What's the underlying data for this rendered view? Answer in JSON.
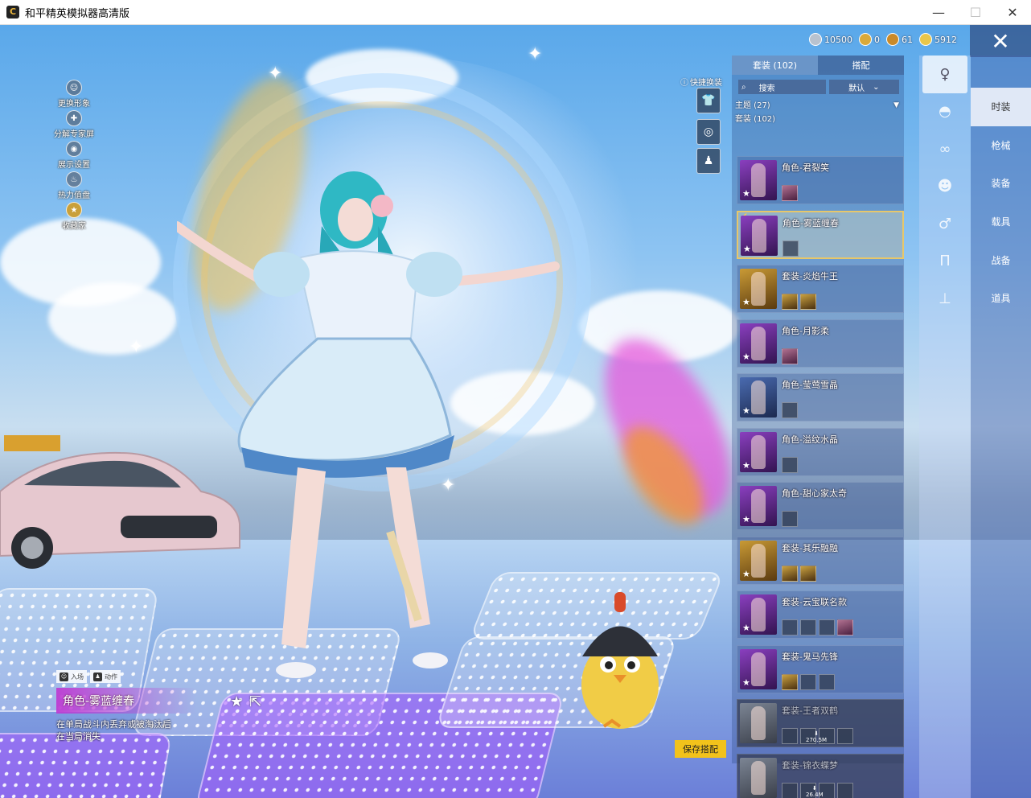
{
  "window": {
    "title": "和平精英模拟器高清版",
    "minimize": "—",
    "maximize": "☐",
    "close": "✕"
  },
  "currencies": [
    {
      "icon": "silver-coin-icon",
      "value": "10500",
      "color": "#b8c2cf"
    },
    {
      "icon": "gold-token-icon",
      "value": "0",
      "color": "#d9a93a"
    },
    {
      "icon": "crown-coin-icon",
      "value": "61",
      "color": "#c98a2a"
    },
    {
      "icon": "diamond-coin-icon",
      "value": "5912",
      "color": "#e9c64a"
    }
  ],
  "left_menu": [
    {
      "label": "更换形象",
      "icon": "avatar-icon"
    },
    {
      "label": "分解专家屏",
      "icon": "puzzle-icon"
    },
    {
      "label": "展示设置",
      "icon": "eye-icon"
    },
    {
      "label": "热力值盘",
      "icon": "flame-icon"
    },
    {
      "label": "收藏家",
      "icon": "collector-badge-icon"
    }
  ],
  "quick_change": {
    "label": "快捷换装"
  },
  "panel": {
    "tabs": [
      {
        "label": "套装 (102)"
      },
      {
        "label": "搭配"
      }
    ],
    "search_placeholder": "搜索",
    "sort_label": "默认",
    "categories": [
      {
        "label": "主题 (27)"
      },
      {
        "label": "套装 (102)"
      }
    ],
    "items": [
      {
        "name": "角色-君裂笑",
        "thumb": "purple"
      },
      {
        "name": "角色-雾蓝缠春",
        "thumb": "purple"
      },
      {
        "name": "套装-炎焰牛王",
        "thumb": "gold"
      },
      {
        "name": "角色-月影柔",
        "thumb": "purple"
      },
      {
        "name": "角色-莹莺雪晶",
        "thumb": "blue"
      },
      {
        "name": "角色-溢纹水晶",
        "thumb": "purple"
      },
      {
        "name": "角色-甜心家太奇",
        "thumb": "purple"
      },
      {
        "name": "套装-其乐融融",
        "thumb": "gold"
      },
      {
        "name": "套装-云宝联名款",
        "thumb": "purple"
      },
      {
        "name": "套装-鬼马先锋",
        "thumb": "purple"
      },
      {
        "name": "套装-王者双鹤",
        "thumb": "gray",
        "download": "270.5M"
      },
      {
        "name": "套装-锦衣蝶梦",
        "thumb": "gray",
        "download": "26.4M"
      }
    ]
  },
  "side_categories": [
    {
      "icon": "full-outfit-icon"
    },
    {
      "icon": "hat-icon"
    },
    {
      "icon": "goggles-icon"
    },
    {
      "icon": "mask-icon"
    },
    {
      "icon": "top-icon"
    },
    {
      "icon": "pants-icon"
    },
    {
      "icon": "shoes-icon"
    }
  ],
  "sections": [
    {
      "label": "时装"
    },
    {
      "label": "枪械"
    },
    {
      "label": "装备"
    },
    {
      "label": "载具"
    },
    {
      "label": "战备"
    },
    {
      "label": "道具"
    }
  ],
  "bottom": {
    "tab_enter": "入场",
    "tab_action": "动作",
    "current_name": "角色-雾蓝缠春",
    "note": "在单局战斗内丢弃或被淘汰后在当局消失",
    "save_label": "保存搭配"
  },
  "colors": {
    "accent_gold": "#f2c21b",
    "rarity_purple": "#be3cd2",
    "selected_border": "#e7c76a"
  }
}
